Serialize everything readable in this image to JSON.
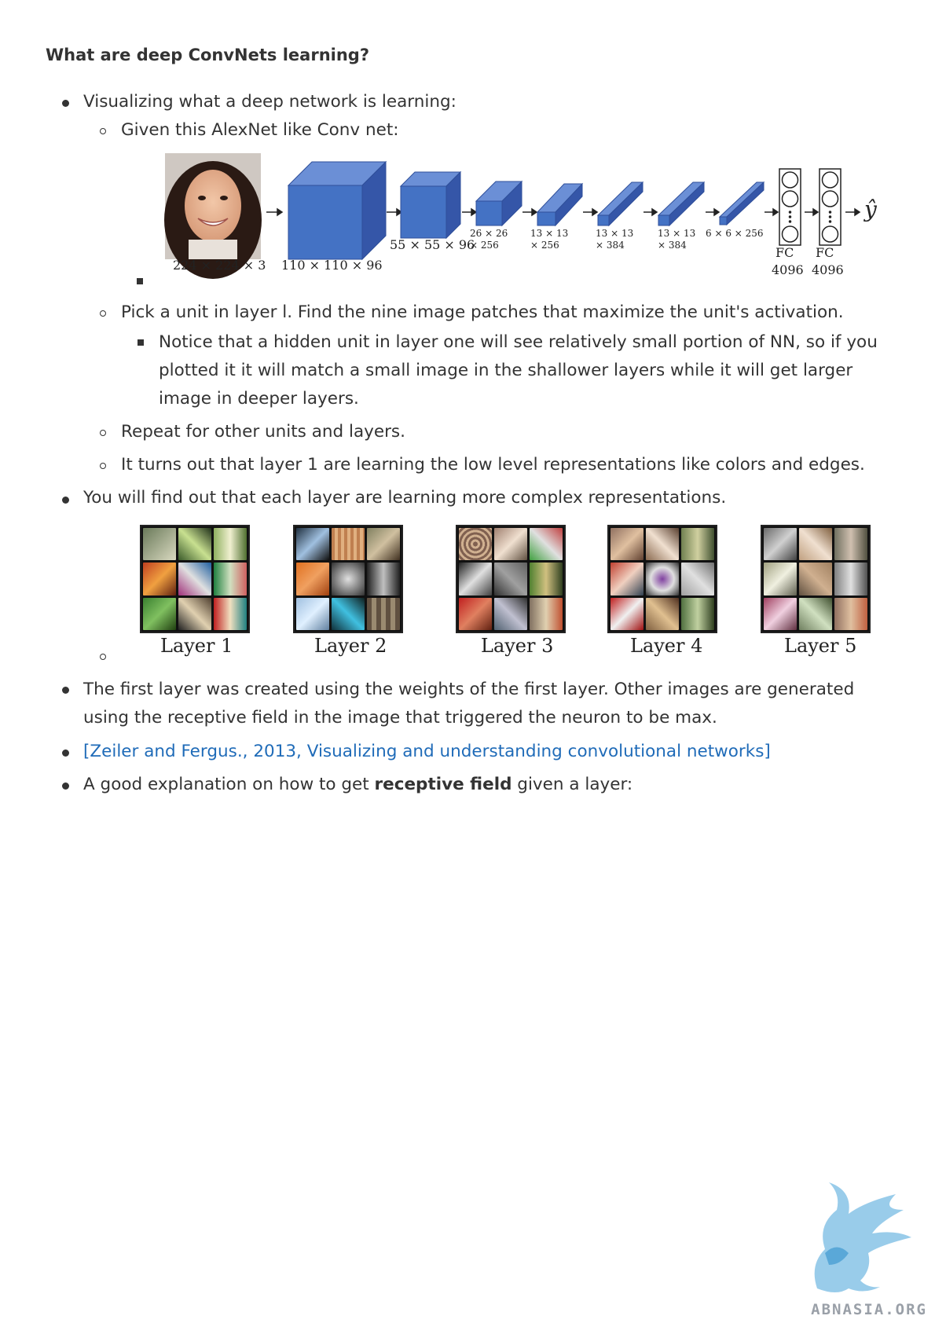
{
  "heading": "What are deep ConvNets learning?",
  "items": {
    "b1": "Visualizing what a deep network is learning:",
    "b1a": "Given this AlexNet like Conv net:",
    "b1b": "Pick a unit in layer l. Find the nine image patches that maximize the unit's activation.",
    "b1b_i": "Notice that a hidden unit in layer one will see relatively small portion of NN, so if you plotted it it will match a small image in the shallower layers while it will get larger image in deeper layers.",
    "b1c": "Repeat for other units and layers.",
    "b1d": "It turns out that layer 1 are learning the low level representations like colors and edges.",
    "b2": "You will find out that each layer are learning more complex representations.",
    "b3": "The first layer was created using the weights of the first layer. Other images are generated using the receptive field in the image that triggered the neuron to be max.",
    "b4_link": "[Zeiler and Fergus., 2013, Visualizing and understanding convolutional networks]",
    "b5_pre": "A good explanation on how to get ",
    "b5_bold": "receptive field",
    "b5_post": " given a layer:"
  },
  "diagram": {
    "input_dim": "224 × 224 × 3",
    "conv1_dim": "110 × 110 × 96",
    "conv2_dim": "55 × 55 × 96",
    "conv3_dim_a": "26 × 26",
    "conv3_dim_b": "× 256",
    "conv4_dim_a": "13 × 13",
    "conv4_dim_b": "× 256",
    "conv5_dim_a": "13 × 13",
    "conv5_dim_b": "× 384",
    "conv6_dim_a": "13 × 13",
    "conv6_dim_b": "× 384",
    "conv7_dim": "6 × 6 × 256",
    "fc1_label": "FC",
    "fc1_size": "4096",
    "fc2_label": "FC",
    "fc2_size": "4096",
    "output": "ŷ"
  },
  "layers": [
    "Layer 1",
    "Layer 2",
    "Layer 3",
    "Layer 4",
    "Layer 5"
  ],
  "watermark": "ABNASIA.ORG",
  "colors": {
    "cube": "#4472c4",
    "link": "#1f6bb8"
  }
}
